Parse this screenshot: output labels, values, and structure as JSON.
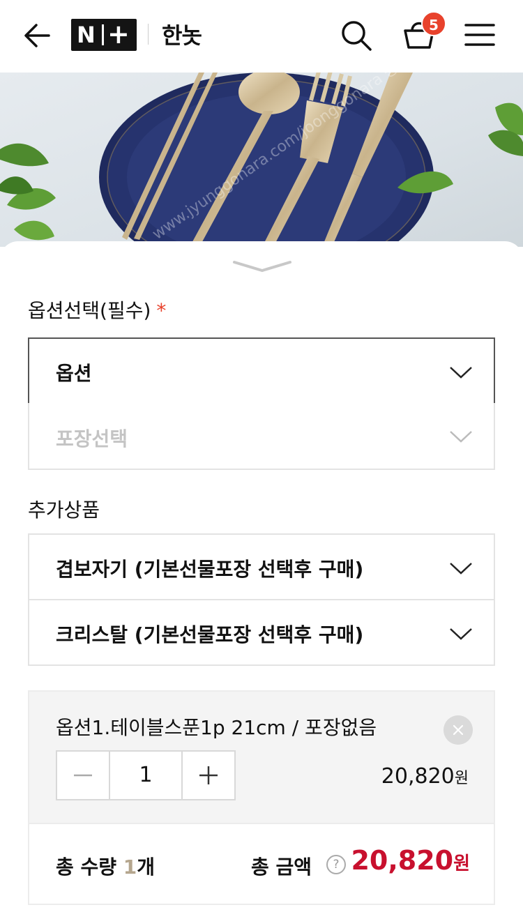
{
  "header": {
    "logo_text": "N+",
    "brand": "한놋",
    "cart_count": "5"
  },
  "hero": {
    "watermark": "www.jyunggonara.com/joonggonara 중고나라 주주니"
  },
  "options": {
    "label": "옵션선택(필수)",
    "required_mark": "*",
    "option_select": "옵션",
    "package_select": "포장선택"
  },
  "addons": {
    "label": "추가상품",
    "items": [
      "겹보자기 (기본선물포장 선택후 구매)",
      "크리스탈 (기본선물포장 선택후 구매)"
    ]
  },
  "selected": {
    "name": "옵션1.테이블스푼1p 21cm / 포장없음",
    "quantity": "1",
    "price": "20,820",
    "price_unit": "원"
  },
  "total": {
    "qty_prefix": "총 수량 ",
    "qty": "1",
    "qty_unit": "개",
    "amount_label": "총 금액",
    "help": "?",
    "amount": "20,820",
    "amount_unit": "원"
  },
  "colors": {
    "accent_red": "#c8102e",
    "badge": "#e8422c"
  }
}
